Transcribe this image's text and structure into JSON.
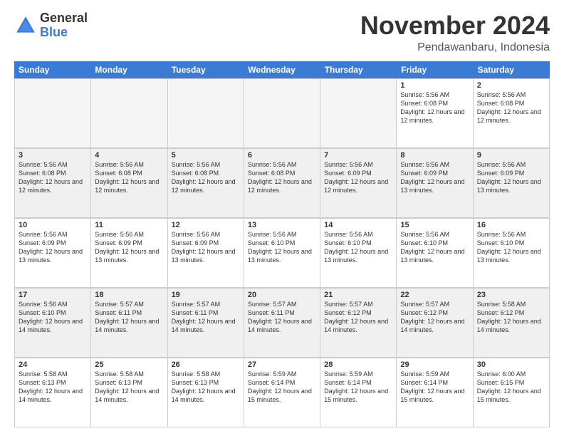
{
  "logo": {
    "general": "General",
    "blue": "Blue"
  },
  "title": "November 2024",
  "subtitle": "Pendawanbaru, Indonesia",
  "header_days": [
    "Sunday",
    "Monday",
    "Tuesday",
    "Wednesday",
    "Thursday",
    "Friday",
    "Saturday"
  ],
  "weeks": [
    [
      {
        "day": "",
        "empty": true
      },
      {
        "day": "",
        "empty": true
      },
      {
        "day": "",
        "empty": true
      },
      {
        "day": "",
        "empty": true
      },
      {
        "day": "",
        "empty": true
      },
      {
        "day": "1",
        "info": "Sunrise: 5:56 AM\nSunset: 6:08 PM\nDaylight: 12 hours\nand 12 minutes."
      },
      {
        "day": "2",
        "info": "Sunrise: 5:56 AM\nSunset: 6:08 PM\nDaylight: 12 hours\nand 12 minutes."
      }
    ],
    [
      {
        "day": "3",
        "info": "Sunrise: 5:56 AM\nSunset: 6:08 PM\nDaylight: 12 hours\nand 12 minutes."
      },
      {
        "day": "4",
        "info": "Sunrise: 5:56 AM\nSunset: 6:08 PM\nDaylight: 12 hours\nand 12 minutes."
      },
      {
        "day": "5",
        "info": "Sunrise: 5:56 AM\nSunset: 6:08 PM\nDaylight: 12 hours\nand 12 minutes."
      },
      {
        "day": "6",
        "info": "Sunrise: 5:56 AM\nSunset: 6:08 PM\nDaylight: 12 hours\nand 12 minutes."
      },
      {
        "day": "7",
        "info": "Sunrise: 5:56 AM\nSunset: 6:09 PM\nDaylight: 12 hours\nand 12 minutes."
      },
      {
        "day": "8",
        "info": "Sunrise: 5:56 AM\nSunset: 6:09 PM\nDaylight: 12 hours\nand 13 minutes."
      },
      {
        "day": "9",
        "info": "Sunrise: 5:56 AM\nSunset: 6:09 PM\nDaylight: 12 hours\nand 13 minutes."
      }
    ],
    [
      {
        "day": "10",
        "info": "Sunrise: 5:56 AM\nSunset: 6:09 PM\nDaylight: 12 hours\nand 13 minutes."
      },
      {
        "day": "11",
        "info": "Sunrise: 5:56 AM\nSunset: 6:09 PM\nDaylight: 12 hours\nand 13 minutes."
      },
      {
        "day": "12",
        "info": "Sunrise: 5:56 AM\nSunset: 6:09 PM\nDaylight: 12 hours\nand 13 minutes."
      },
      {
        "day": "13",
        "info": "Sunrise: 5:56 AM\nSunset: 6:10 PM\nDaylight: 12 hours\nand 13 minutes."
      },
      {
        "day": "14",
        "info": "Sunrise: 5:56 AM\nSunset: 6:10 PM\nDaylight: 12 hours\nand 13 minutes."
      },
      {
        "day": "15",
        "info": "Sunrise: 5:56 AM\nSunset: 6:10 PM\nDaylight: 12 hours\nand 13 minutes."
      },
      {
        "day": "16",
        "info": "Sunrise: 5:56 AM\nSunset: 6:10 PM\nDaylight: 12 hours\nand 13 minutes."
      }
    ],
    [
      {
        "day": "17",
        "info": "Sunrise: 5:56 AM\nSunset: 6:10 PM\nDaylight: 12 hours\nand 14 minutes."
      },
      {
        "day": "18",
        "info": "Sunrise: 5:57 AM\nSunset: 6:11 PM\nDaylight: 12 hours\nand 14 minutes."
      },
      {
        "day": "19",
        "info": "Sunrise: 5:57 AM\nSunset: 6:11 PM\nDaylight: 12 hours\nand 14 minutes."
      },
      {
        "day": "20",
        "info": "Sunrise: 5:57 AM\nSunset: 6:11 PM\nDaylight: 12 hours\nand 14 minutes."
      },
      {
        "day": "21",
        "info": "Sunrise: 5:57 AM\nSunset: 6:12 PM\nDaylight: 12 hours\nand 14 minutes."
      },
      {
        "day": "22",
        "info": "Sunrise: 5:57 AM\nSunset: 6:12 PM\nDaylight: 12 hours\nand 14 minutes."
      },
      {
        "day": "23",
        "info": "Sunrise: 5:58 AM\nSunset: 6:12 PM\nDaylight: 12 hours\nand 14 minutes."
      }
    ],
    [
      {
        "day": "24",
        "info": "Sunrise: 5:58 AM\nSunset: 6:13 PM\nDaylight: 12 hours\nand 14 minutes."
      },
      {
        "day": "25",
        "info": "Sunrise: 5:58 AM\nSunset: 6:13 PM\nDaylight: 12 hours\nand 14 minutes."
      },
      {
        "day": "26",
        "info": "Sunrise: 5:58 AM\nSunset: 6:13 PM\nDaylight: 12 hours\nand 14 minutes."
      },
      {
        "day": "27",
        "info": "Sunrise: 5:59 AM\nSunset: 6:14 PM\nDaylight: 12 hours\nand 15 minutes."
      },
      {
        "day": "28",
        "info": "Sunrise: 5:59 AM\nSunset: 6:14 PM\nDaylight: 12 hours\nand 15 minutes."
      },
      {
        "day": "29",
        "info": "Sunrise: 5:59 AM\nSunset: 6:14 PM\nDaylight: 12 hours\nand 15 minutes."
      },
      {
        "day": "30",
        "info": "Sunrise: 6:00 AM\nSunset: 6:15 PM\nDaylight: 12 hours\nand 15 minutes."
      }
    ]
  ]
}
